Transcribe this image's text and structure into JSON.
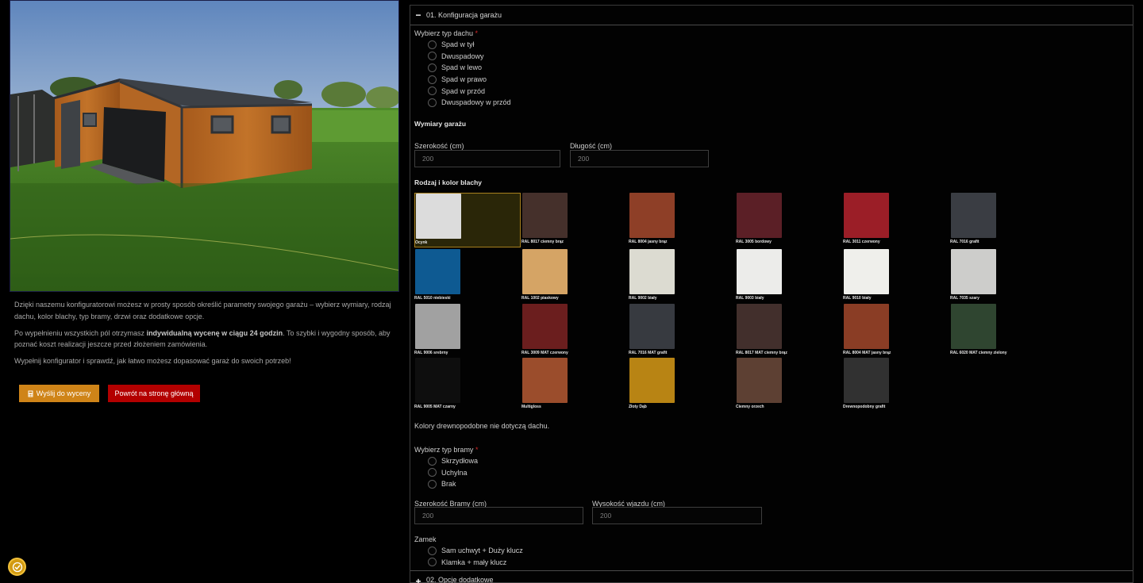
{
  "intro": {
    "p1": "Dzięki naszemu konfiguratorowi możesz w prosty sposób określić parametry swojego garażu – wybierz wymiary, rodzaj dachu, kolor blachy, typ bramy, drzwi oraz dodatkowe opcje.",
    "p2_pre": "Po wypełnieniu wszystkich pól otrzymasz ",
    "p2_bold": "indywidualną wycenę w ciągu 24 godzin",
    "p2_post": ". To szybki i wygodny sposób, aby poznać koszt realizacji jeszcze przed złożeniem zamówienia.",
    "p3": "Wypełnij konfigurator i sprawdź, jak łatwo możesz dopasować garaż do swoich potrzeb!"
  },
  "buttons": {
    "quote": "Wyślij do wyceny",
    "home": "Powrót na stronę główną"
  },
  "accordion": {
    "section1": "01. Konfiguracja garażu",
    "section1_sign": "−",
    "section2": "02. Opcje dodatkowe",
    "section2_sign": "+"
  },
  "roof": {
    "label": "Wybierz typ dachu",
    "required": "*",
    "options": [
      "Spad w tył",
      "Dwuspadowy",
      "Spad w lewo",
      "Spad w prawo",
      "Spad w przód",
      "Dwuspadowy w przód"
    ]
  },
  "dimensions": {
    "title": "Wymiary garażu",
    "width_label": "Szerokość (cm)",
    "width_placeholder": "200",
    "length_label": "Długość (cm)",
    "length_placeholder": "200"
  },
  "sheet": {
    "title": "Rodzaj i kolor blachy",
    "selected": "Ocynk",
    "swatches": [
      {
        "name": "Ocynk",
        "color": "#dcdcdc"
      },
      {
        "name": "RAL 8017 ciemny brąz",
        "color": "#45302b"
      },
      {
        "name": "RAL 8004 jasny brąz",
        "color": "#8e3f27"
      },
      {
        "name": "RAL 3005 bordowy",
        "color": "#5b1f26"
      },
      {
        "name": "RAL 3011 czerwony",
        "color": "#9b1e27"
      },
      {
        "name": "RAL 7016 grafit",
        "color": "#3a3d43"
      },
      {
        "name": "RAL 5010 niebieski",
        "color": "#0e5a92"
      },
      {
        "name": "RAL 1002 piaskowy",
        "color": "#d5a465"
      },
      {
        "name": "RAL 9002 biały",
        "color": "#dcdbd1"
      },
      {
        "name": "RAL 9003 biały",
        "color": "#ececea"
      },
      {
        "name": "RAL 9010 biały",
        "color": "#efefeb"
      },
      {
        "name": "RAL 7035 szary",
        "color": "#cdcdcb"
      },
      {
        "name": "RAL 9006 srebrny",
        "color": "#a1a1a1"
      },
      {
        "name": "RAL 3009 MAT czerwony",
        "color": "#6b1e1e"
      },
      {
        "name": "RAL 7016 MAT grafit",
        "color": "#373a40"
      },
      {
        "name": "RAL 8017 MAT ciemny brąz",
        "color": "#422f2c"
      },
      {
        "name": "RAL 8004 MAT jasny brąz",
        "color": "#8a3d25"
      },
      {
        "name": "RAL 6020 MAT ciemny zielony",
        "color": "#2f4530"
      },
      {
        "name": "RAL 9005 MAT czarny",
        "color": "#0e0e0e"
      },
      {
        "name": "Multigloss",
        "color": "#9b4d2c"
      },
      {
        "name": "Złoty Dąb",
        "color": "#b88414"
      },
      {
        "name": "Ciemny orzech",
        "color": "#5d4033"
      },
      {
        "name": "Drewnopodobny grafit",
        "color": "#313131"
      }
    ],
    "note": "Kolory drewnopodobne nie dotyczą dachu."
  },
  "gate": {
    "label": "Wybierz typ bramy",
    "required": "*",
    "options": [
      "Skrzydłowa",
      "Uchylna",
      "Brak"
    ],
    "width_label": "Szerokość Bramy (cm)",
    "width_placeholder": "200",
    "height_label": "Wysokość wjazdu (cm)",
    "height_placeholder": "200"
  },
  "lock": {
    "label": "Zamek",
    "options": [
      "Sam uchwyt + Duży klucz",
      "Klamka + mały klucz"
    ]
  },
  "colors": {
    "quote_button": "#cf8418",
    "home_button": "#b30000",
    "selected_border": "#a8801e",
    "required": "#d42828"
  },
  "icons": {
    "quote": "calculator-icon",
    "widget": "accessibility-badge-icon"
  }
}
